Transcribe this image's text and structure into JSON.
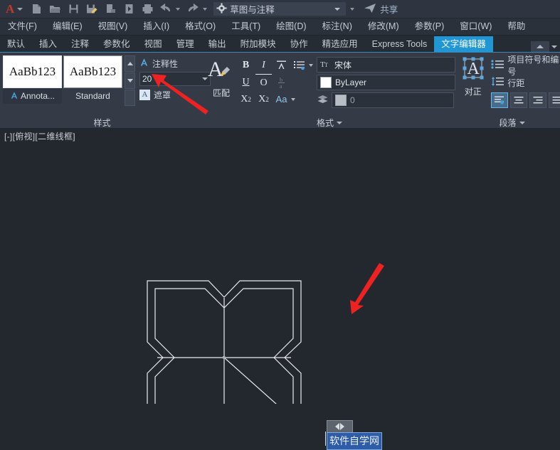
{
  "titlebar": {
    "logo": "A",
    "quick_access": [
      {
        "name": "new-file-icon",
        "label": "新建"
      },
      {
        "name": "open-file-icon",
        "label": "打开"
      },
      {
        "name": "save-icon",
        "label": "保存"
      },
      {
        "name": "save-as-icon",
        "label": "另存为"
      },
      {
        "name": "export-icon",
        "label": "输出"
      },
      {
        "name": "plot-preview-icon",
        "label": "打印预览"
      },
      {
        "name": "print-icon",
        "label": "打印"
      },
      {
        "name": "undo-icon",
        "label": "放弃"
      },
      {
        "name": "redo-icon",
        "label": "重做"
      }
    ],
    "workspace": "草图与注释",
    "share_label": "共享"
  },
  "menubar": {
    "items": [
      {
        "label": "文件(F)"
      },
      {
        "label": "编辑(E)"
      },
      {
        "label": "视图(V)"
      },
      {
        "label": "插入(I)"
      },
      {
        "label": "格式(O)"
      },
      {
        "label": "工具(T)"
      },
      {
        "label": "绘图(D)"
      },
      {
        "label": "标注(N)"
      },
      {
        "label": "修改(M)"
      },
      {
        "label": "参数(P)"
      },
      {
        "label": "窗口(W)"
      },
      {
        "label": "帮助"
      }
    ]
  },
  "ribbon_tabs": {
    "items": [
      {
        "label": "默认",
        "active": false
      },
      {
        "label": "插入",
        "active": false
      },
      {
        "label": "注释",
        "active": false
      },
      {
        "label": "参数化",
        "active": false
      },
      {
        "label": "视图",
        "active": false
      },
      {
        "label": "管理",
        "active": false
      },
      {
        "label": "输出",
        "active": false
      },
      {
        "label": "附加模块",
        "active": false
      },
      {
        "label": "协作",
        "active": false
      },
      {
        "label": "精选应用",
        "active": false
      },
      {
        "label": "Express Tools",
        "active": false
      },
      {
        "label": "文字编辑器",
        "active": true
      }
    ]
  },
  "style_panel": {
    "title": "样式",
    "gallery": [
      {
        "preview": "AaBb123",
        "name": "Annota...",
        "annotative": true
      },
      {
        "preview": "AaBb123",
        "name": "Standard",
        "annotative": false
      }
    ],
    "annotative_label": "注释性",
    "height_value": "20",
    "mask_label": "遮罩"
  },
  "format_panel": {
    "title": "格式",
    "match_label": "匹配",
    "bold": "B",
    "italic": "I",
    "underline": "U",
    "overline": "O",
    "superscript": "X",
    "superscript_sup": "2",
    "subscript": "X",
    "subscript_sub": "2",
    "case_label": "Aa",
    "stack_label": "b/a",
    "font": "宋体",
    "color": "ByLayer",
    "layer": "0"
  },
  "paragraph_panel": {
    "title": "段落",
    "justify_label": "对正",
    "bullets_label": "项目符号和编号",
    "linespacing_label": "行距",
    "align_buttons": [
      {
        "name": "align-left",
        "selected": true
      },
      {
        "name": "align-center",
        "selected": false
      },
      {
        "name": "align-right",
        "selected": false
      },
      {
        "name": "align-justify",
        "selected": false
      }
    ]
  },
  "canvas": {
    "viewport_label": "[-][俯视][二维线框]",
    "text_editor": {
      "value": "软件自学网",
      "selected": true
    },
    "colors": {
      "background": "#23282e",
      "geometry": "#e8ebef",
      "annotation_arrow": "#ee2222",
      "selection": "#2f5ca8",
      "accent": "#2196d4"
    },
    "geometry_description": "四瓣星形轮廓（带内偏移）与中心十字线及引线"
  }
}
